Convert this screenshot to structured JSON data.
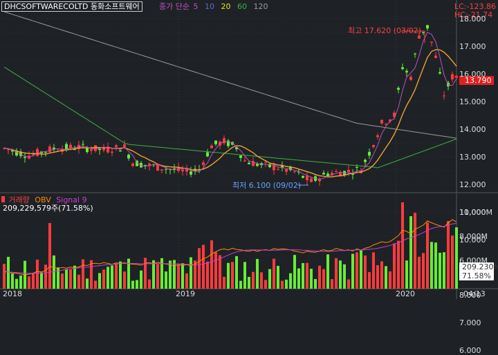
{
  "header": {
    "symbol": "DHCSOFTWARECOLTD",
    "name": "동화소프트웨어",
    "ma_label": "종가 단순",
    "ma_periods": [
      "5",
      "10",
      "20",
      "60",
      "120"
    ],
    "ma_colors": [
      "#c050c0",
      "#5a6cc8",
      "#e8e020",
      "#40b040",
      "#9a9a9a"
    ],
    "lc": "LC:-123.86",
    "hc": "HC:-21.74"
  },
  "price_panel": {
    "high_annotation": "최고 17.620 (03/02)",
    "low_annotation": "최저 6.100 (09/02)",
    "current_price": "13.790",
    "y_ticks": [
      "18.000",
      "17.000",
      "16.000",
      "15.000",
      "14.000",
      "13.000",
      "12.000",
      "11.000",
      "10.000",
      "9.000",
      "8.000",
      "7.000",
      "6.000"
    ]
  },
  "volume_panel": {
    "legend_volume": "거래량",
    "legend_obv": "OBV",
    "legend_signal": "Signal 9",
    "volume_text": "209,229,579주(71.58%)",
    "y_ticks": [
      "10,000M",
      "8,000M",
      "6,000M"
    ],
    "obv_box": "209.230M",
    "pct_box": "71.58%"
  },
  "x_axis": {
    "labels": [
      "2018",
      "2019",
      "2020",
      "04/13"
    ]
  },
  "colors": {
    "background": "#1e2227",
    "up": "#ff3b3b",
    "down": "#66ee33",
    "obv": "#ff8c00",
    "signal": "#d03cd0",
    "ma20": "#f0a030",
    "ma60": "#40b040",
    "ma120": "#9a9a9a"
  },
  "chart_data": {
    "type": "candlestick",
    "price_range": [
      6.0,
      18.0
    ],
    "high": {
      "value": 17.62,
      "date": "03/02"
    },
    "low": {
      "value": 6.1,
      "date": "09/02"
    },
    "last_close": 13.79,
    "volume_range_M": [
      4000,
      11000
    ],
    "obv_last_M": 209.23,
    "obv_pct": 71.58
  }
}
